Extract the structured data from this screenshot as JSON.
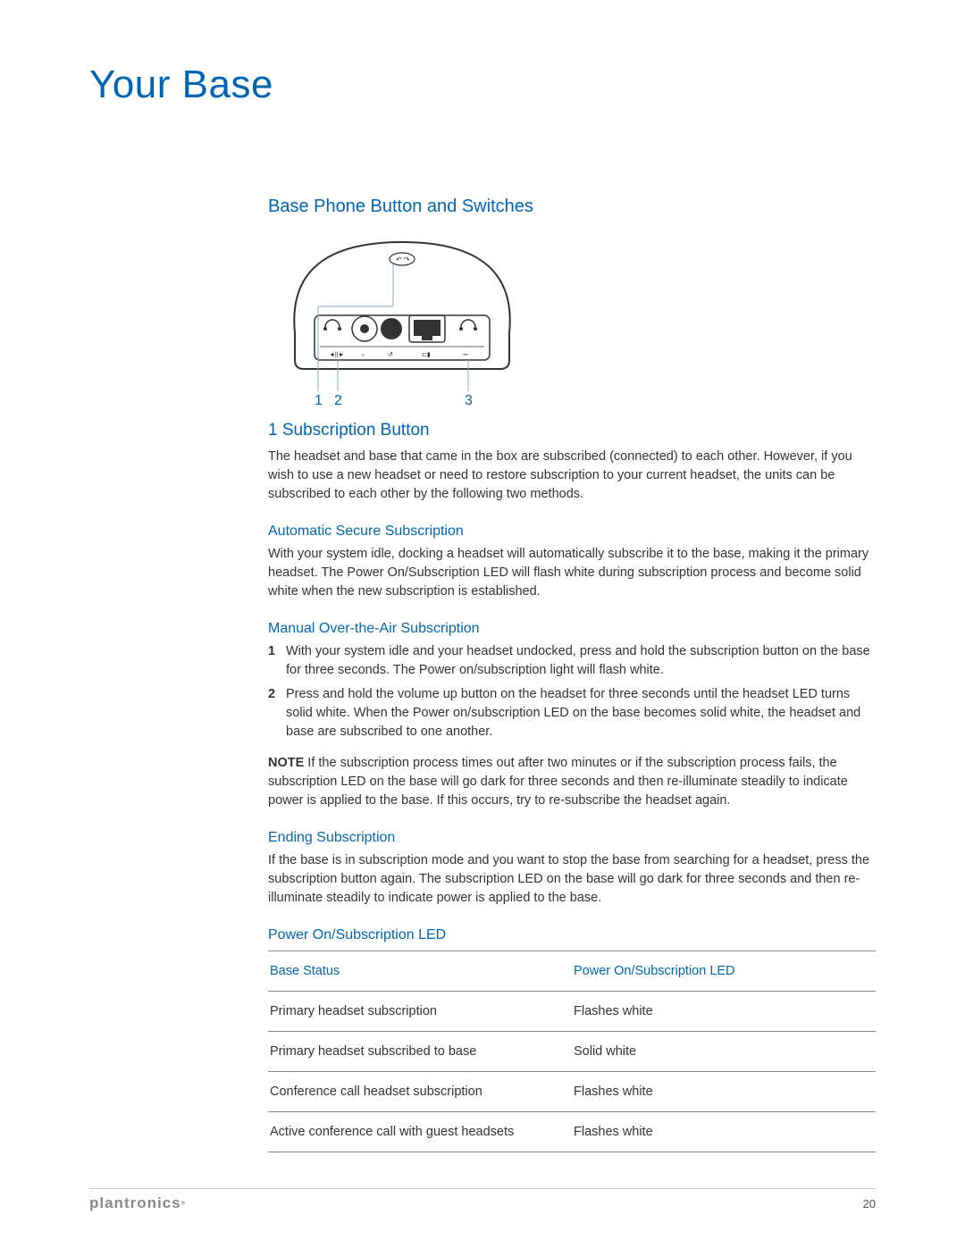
{
  "page_title": "Your Base",
  "sections": {
    "base_phone": "Base Phone Button and Switches",
    "subscription": "1 Subscription Button",
    "subscription_intro": "The headset and base that came in the box are subscribed (connected) to each other. However, if you wish to use a new headset or need to restore subscription to your current headset, the units can be subscribed to each other by the following two methods.",
    "auto_sub_h": "Automatic Secure Subscription",
    "auto_sub_p": "With your system idle, docking a headset will automatically subscribe it to the base, making it the primary headset. The Power On/Subscription LED will flash white during subscription process and become solid white when the new subscription is established.",
    "manual_sub_h": "Manual Over-the-Air Subscription",
    "manual_sub_1": "With your system idle and your headset undocked, press and hold the subscription button on the base for three seconds. The Power on/subscription light will flash white.",
    "manual_sub_2": "Press and hold the volume up button on the headset for three seconds until the headset LED turns solid white. When the Power on/subscription LED on the base becomes solid white, the headset and base are subscribed to one another.",
    "note_label": "NOTE",
    "note_text": " If the subscription process times out after two minutes or if the subscription process fails, the subscription LED on the base will go dark for three seconds and then re-illuminate steadily to indicate power is applied to the base. If this occurs, try to re-subscribe the headset again.",
    "ending_h": "Ending Subscription",
    "ending_p": "If the base is in subscription mode and you want to stop the base from searching for a headset, press the subscription button again. The subscription LED on the base will go dark for three seconds and then re-illuminate steadily to indicate power is applied to the base.",
    "led_h": "Power On/Subscription LED"
  },
  "table": {
    "col1": "Base Status",
    "col2": "Power On/Subscription LED",
    "rows": [
      {
        "status": "Primary headset subscription",
        "led": "Flashes white"
      },
      {
        "status": "Primary headset subscribed to base",
        "led": "Solid white"
      },
      {
        "status": "Conference call headset subscription",
        "led": "Flashes white"
      },
      {
        "status": "Active conference call with guest headsets",
        "led": "Flashes white"
      }
    ]
  },
  "diagram": {
    "callouts": [
      "1",
      "2",
      "3"
    ]
  },
  "footer": {
    "brand": "plantronics",
    "page": "20"
  }
}
